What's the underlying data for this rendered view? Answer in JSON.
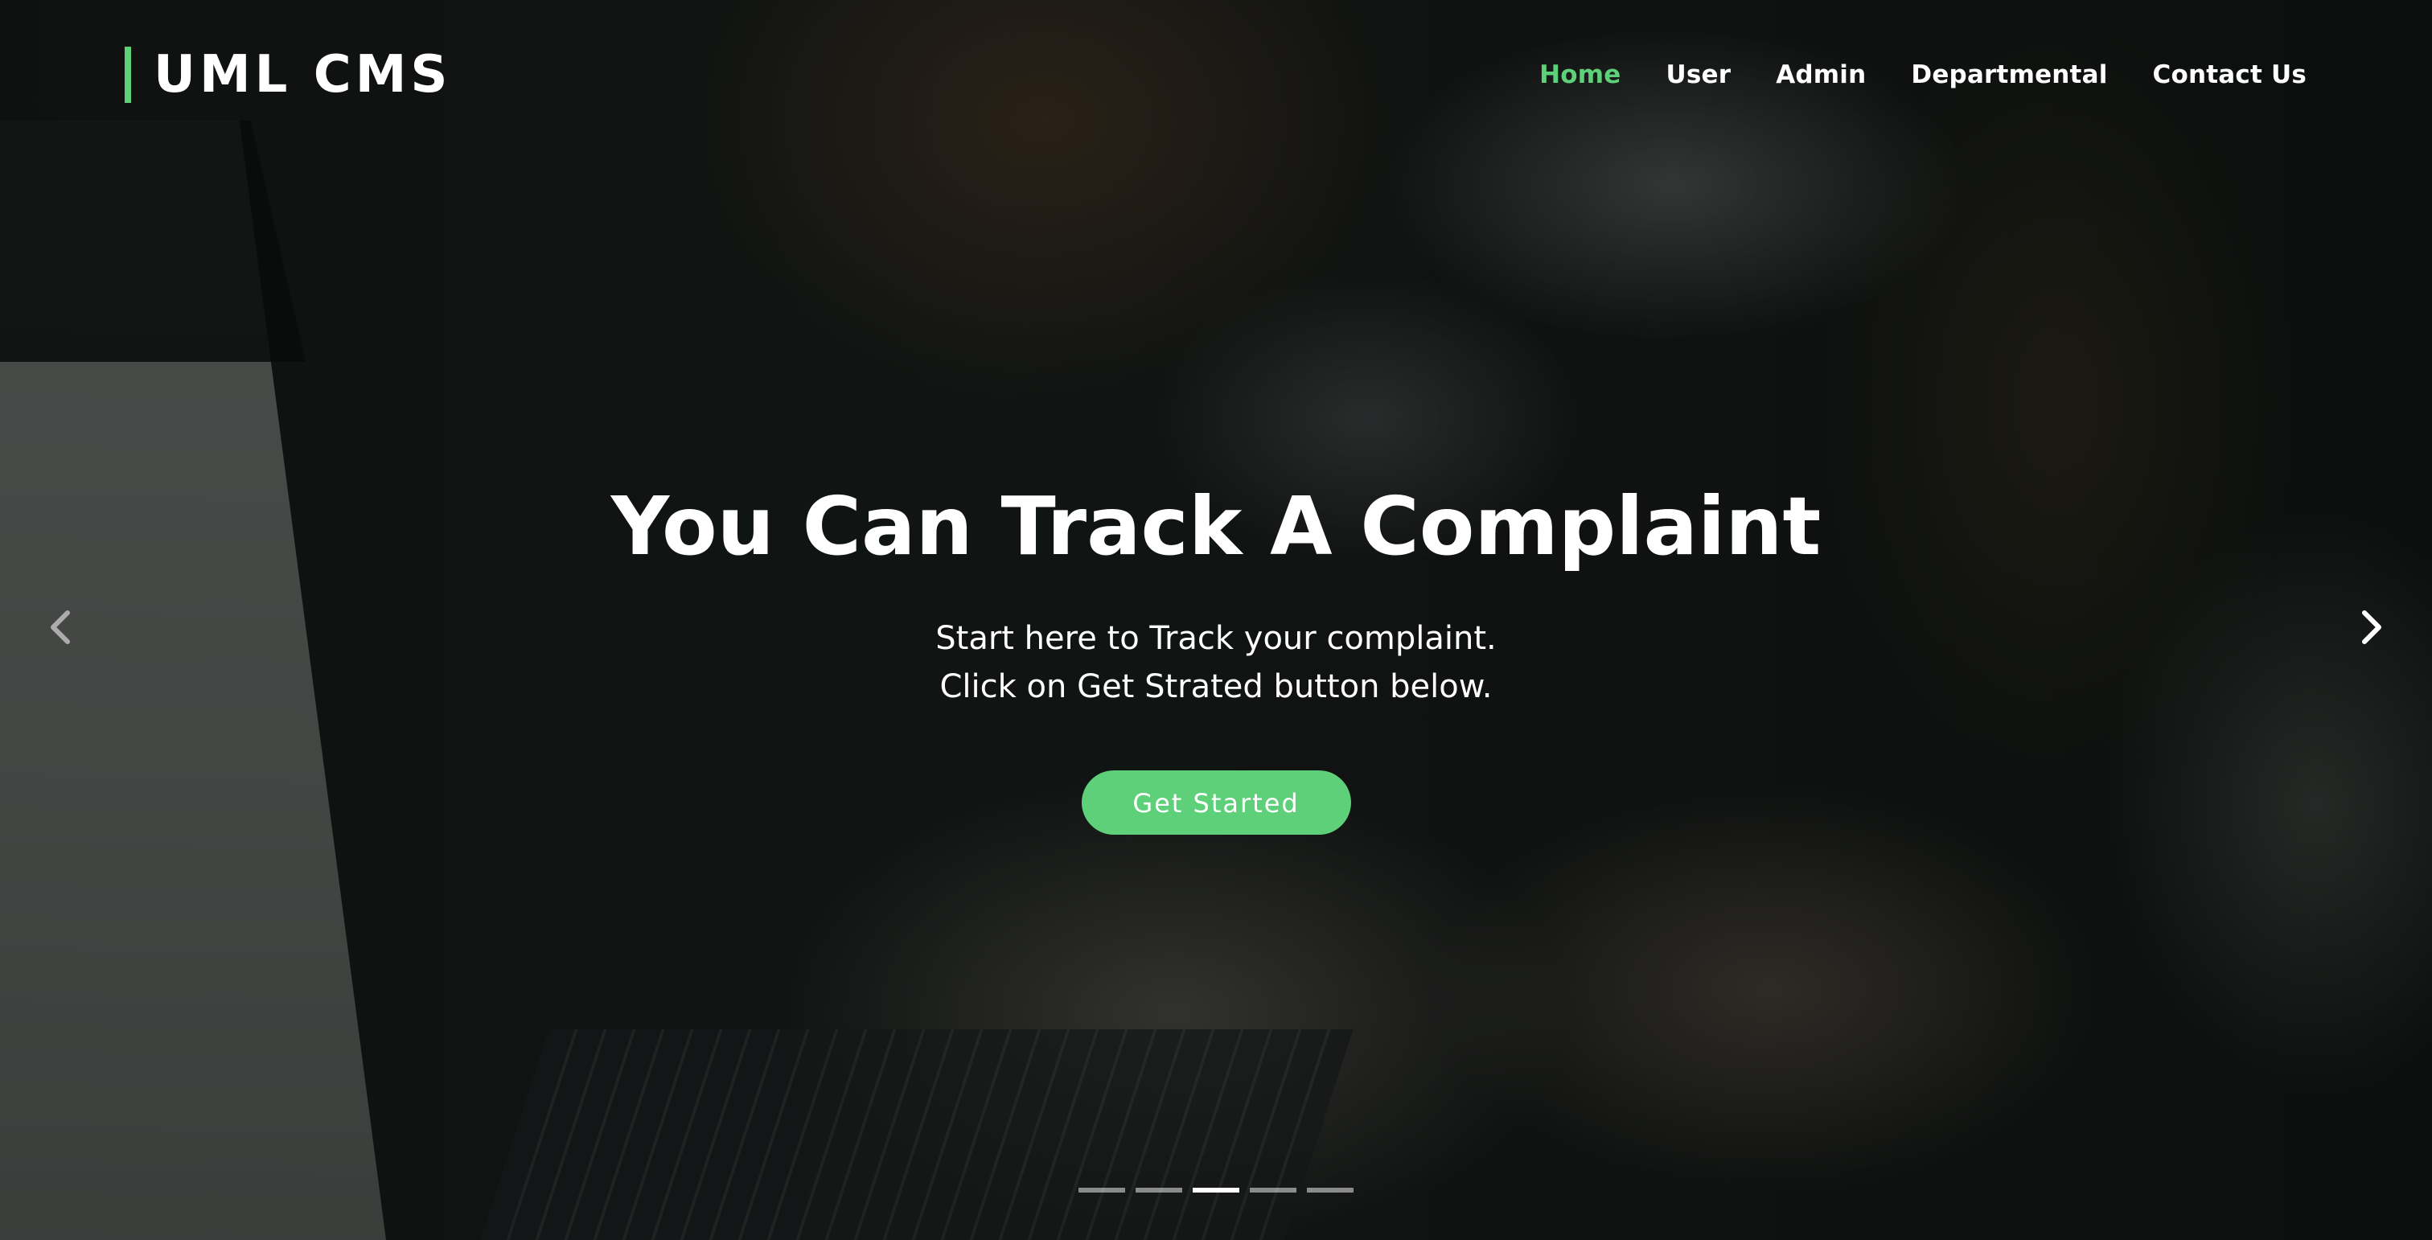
{
  "brand": {
    "name": "UML CMS",
    "accent_color": "#5fd07a"
  },
  "nav": {
    "items": [
      {
        "label": "Home",
        "active": true
      },
      {
        "label": "User",
        "active": false
      },
      {
        "label": "Admin",
        "active": false
      },
      {
        "label": "Departmental",
        "active": false
      },
      {
        "label": "Contact Us",
        "active": false
      }
    ]
  },
  "hero": {
    "title": "You Can Track A Complaint",
    "subtitle_line1": "Start here to Track your complaint.",
    "subtitle_line2": "Click on Get Strated button below.",
    "cta_label": "Get Started"
  },
  "carousel": {
    "prev_icon": "chevron-left-icon",
    "next_icon": "chevron-right-icon",
    "slide_count": 5,
    "active_index": 2
  }
}
